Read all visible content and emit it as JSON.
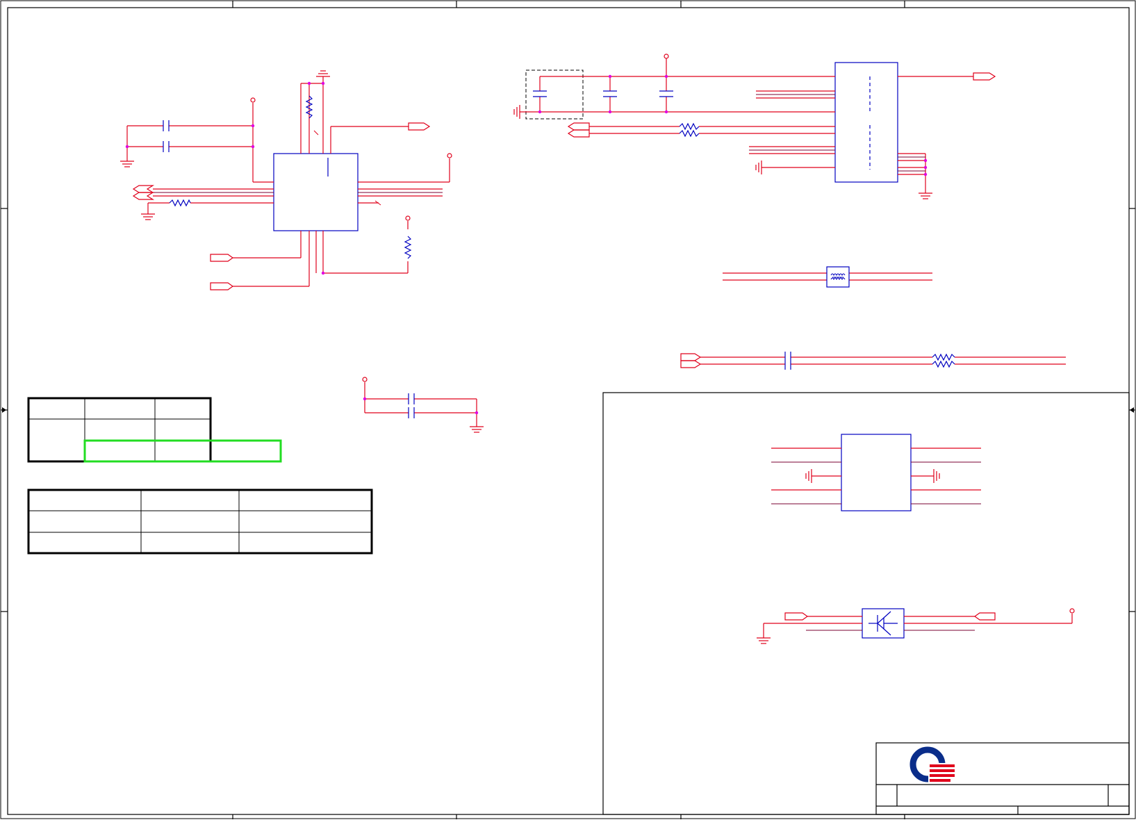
{
  "sheet": {
    "title_block": {
      "logo": "company-logo"
    },
    "colors": {
      "wire": "#e0001b",
      "wire_alt": "#7a0030",
      "component": "#0000c0",
      "junction": "#e000e0",
      "border": "#000000",
      "highlight": "#22dd22",
      "logo_blue": "#0a2d8a",
      "logo_red": "#e0001b"
    }
  },
  "blocks": [
    "left-ic-block",
    "top-right-ic-block",
    "common-mode-choke-block",
    "coupling-network-block",
    "eight-pin-ic-block",
    "transistor-block"
  ],
  "tables": {
    "table_1": {
      "rows": 3,
      "cols": 3
    },
    "table_2": {
      "rows": 3,
      "cols": 3
    }
  }
}
